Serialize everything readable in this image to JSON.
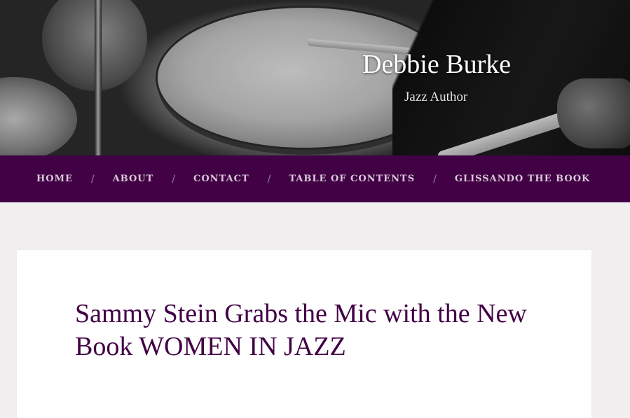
{
  "header": {
    "site_title": "Debbie Burke",
    "site_description": "Jazz Author"
  },
  "nav": {
    "items": [
      {
        "label": "HOME"
      },
      {
        "label": "ABOUT"
      },
      {
        "label": "CONTACT"
      },
      {
        "label": "TABLE OF CONTENTS"
      },
      {
        "label": "GLISSANDO THE BOOK"
      }
    ],
    "separator": "/"
  },
  "post": {
    "title": "Sammy Stein Grabs the Mic with the New Book WOMEN IN JAZZ"
  },
  "colors": {
    "nav_background": "#420145",
    "title_color": "#420145",
    "page_background": "#f1eff0"
  }
}
